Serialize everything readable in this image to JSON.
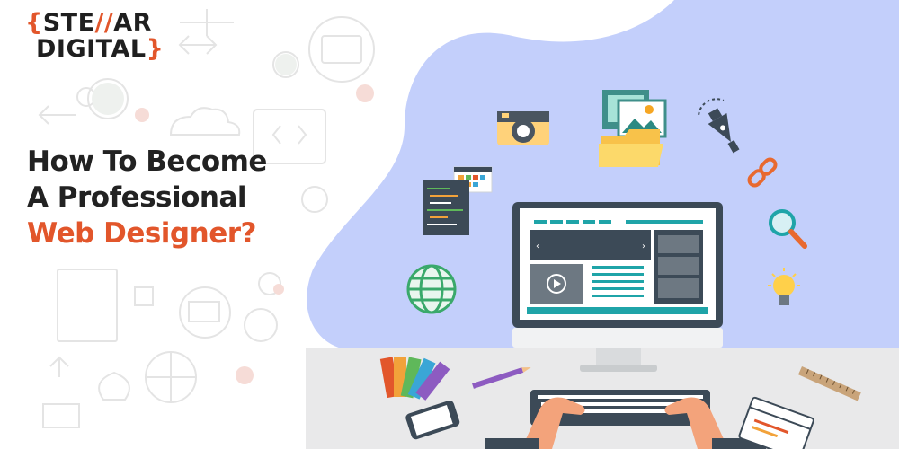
{
  "logo": {
    "open_brace": "{",
    "line1_left": "STE",
    "line1_slashes": "//",
    "line1_right": "AR",
    "line2": "DIGITAL",
    "close_brace": "}",
    "accent_color": "#e2562b"
  },
  "headline": {
    "line1": "How To Become",
    "line2": "A Professional",
    "line3": "Web Designer?",
    "text_color": "#222222",
    "accent_color": "#e2562b"
  },
  "illustration": {
    "blob_color": "#c3cffb",
    "desk_color": "#e9e9ea",
    "monitor_accent": "#1fa4a8",
    "icons": [
      "camera-icon",
      "image-folder-icon",
      "pen-tool-icon",
      "link-icon",
      "magnifier-icon",
      "lightbulb-icon",
      "globe-icon",
      "code-window-icon",
      "color-swatch-icon",
      "pencil-icon",
      "smartphone-icon",
      "keyboard-icon",
      "notebook-icon",
      "ruler-icon"
    ]
  }
}
